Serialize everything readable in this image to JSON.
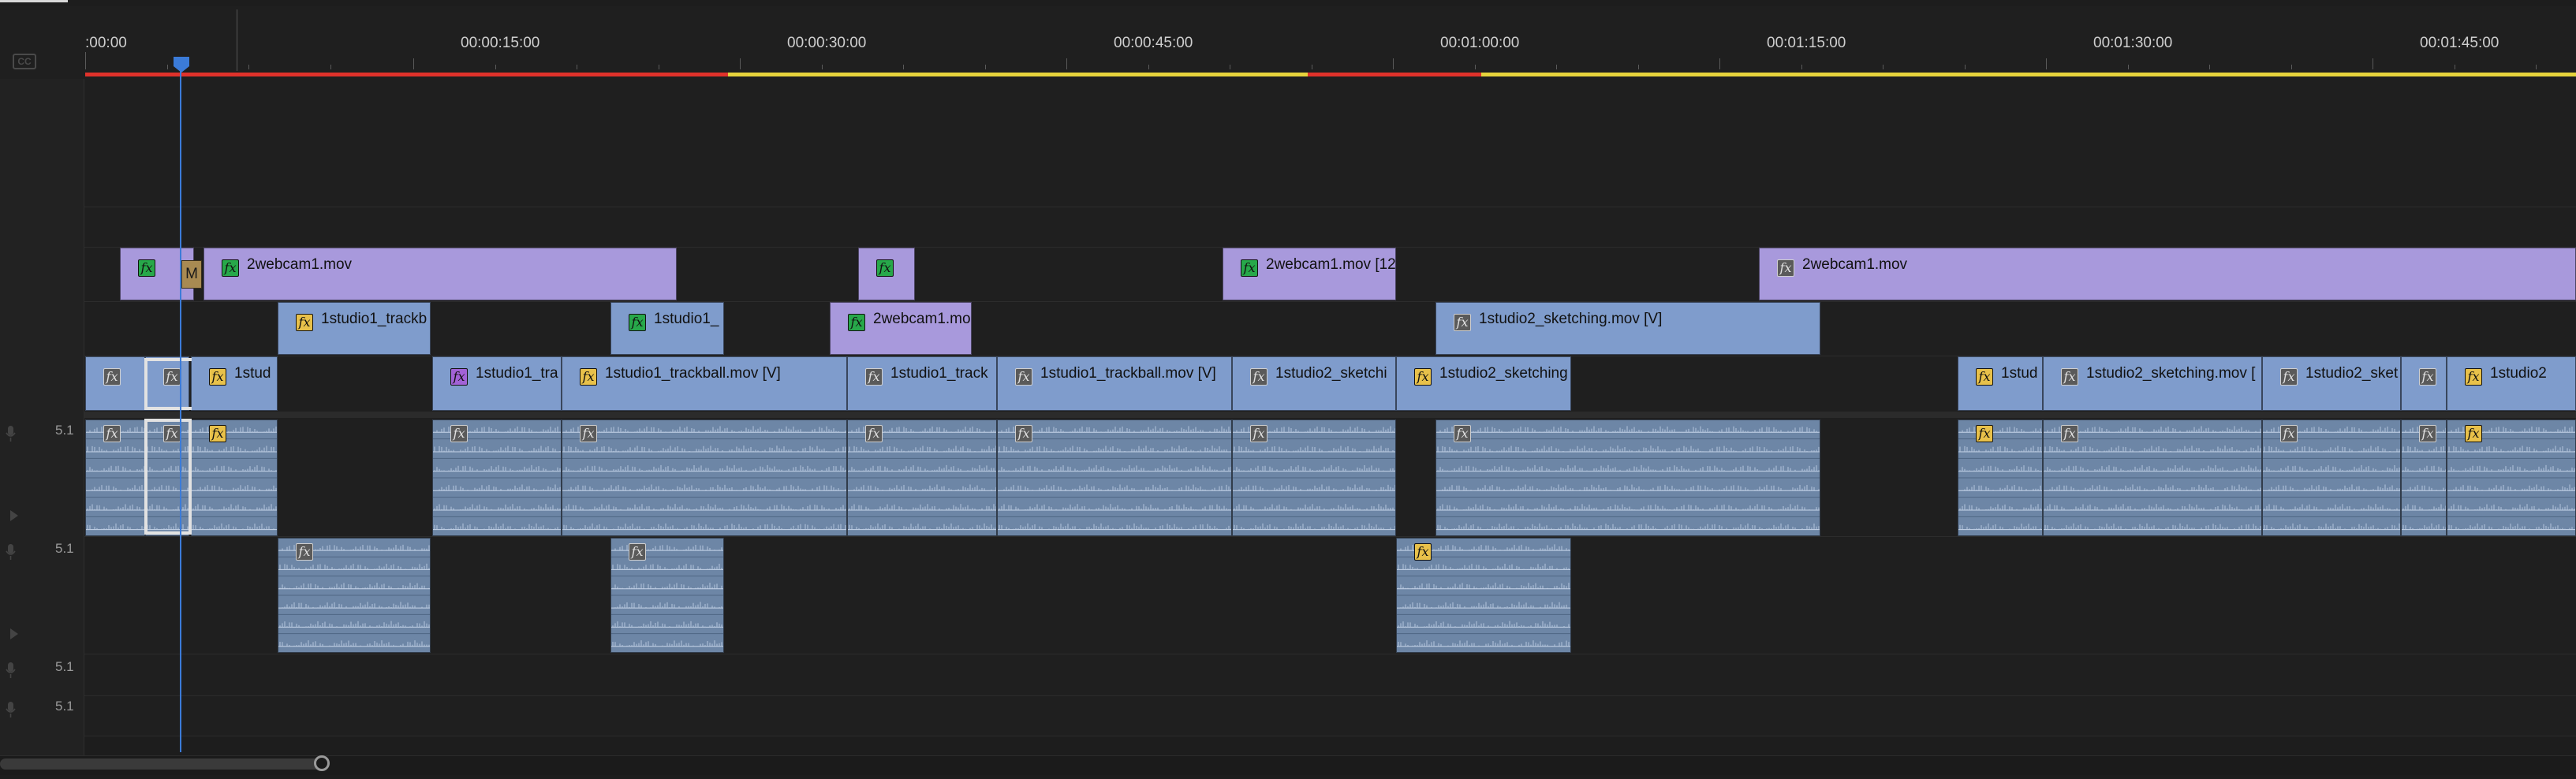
{
  "timecodes": [
    ":00:00",
    "00:00:15:00",
    "00:00:30:00",
    "00:00:45:00",
    "00:01:00:00",
    "00:01:15:00",
    "00:01:30:00",
    "00:01:45:00"
  ],
  "cc_label": "CC",
  "colors": {
    "video": "#7f9ccc",
    "video_purple": "#a899dc",
    "audio": "#6d86a6",
    "playhead": "#3b7bd8",
    "render_red": "#e0322b",
    "render_yellow": "#e6d33c",
    "fx_green": "#27a84a",
    "fx_yellow": "#e8c14a",
    "fx_gray": "#5a5a5a",
    "fx_purple": "#a262d6"
  },
  "audio_tracks": [
    {
      "label": "5.1"
    },
    {
      "label": "5.1"
    },
    {
      "label": "5.1"
    },
    {
      "label": "5.1"
    }
  ],
  "marker_label": "M",
  "clips": {
    "v3": [
      {
        "name": "",
        "fx": "green",
        "color": "purple"
      },
      {
        "name": "2webcam1.mov",
        "fx": "green",
        "color": "purple"
      },
      {
        "name": "",
        "fx": "green",
        "color": "purple"
      },
      {
        "name": "2webcam1.mov [12",
        "fx": "green",
        "color": "purple"
      },
      {
        "name": "2webcam1.mov",
        "fx": "gray",
        "color": "purple"
      }
    ],
    "v2": [
      {
        "name": "1studio1_trackb",
        "fx": "yellow",
        "color": "blue"
      },
      {
        "name": "1studio1_",
        "fx": "green",
        "color": "blue"
      },
      {
        "name": "2webcam1.mo",
        "fx": "green",
        "color": "purple"
      },
      {
        "name": "1studio2_sketching.mov [V]",
        "fx": "gray",
        "color": "blue"
      }
    ],
    "v1": [
      {
        "name": "",
        "fx": "gray",
        "color": "blue"
      },
      {
        "name": "",
        "fx": "gray",
        "color": "blue"
      },
      {
        "name": "1stud",
        "fx": "yellow",
        "color": "blue"
      },
      {
        "name": "1studio1_tra",
        "fx": "purple",
        "color": "blue"
      },
      {
        "name": "1studio1_trackball.mov [V]",
        "fx": "yellow",
        "color": "blue"
      },
      {
        "name": "1studio1_track",
        "fx": "gray",
        "color": "blue"
      },
      {
        "name": "1studio1_trackball.mov [V]",
        "fx": "gray",
        "color": "blue"
      },
      {
        "name": "1studio2_sketchi",
        "fx": "gray",
        "color": "blue"
      },
      {
        "name": "1studio2_sketching",
        "fx": "yellow",
        "color": "blue"
      },
      {
        "name": "1stud",
        "fx": "yellow",
        "color": "blue"
      },
      {
        "name": "1studio2_sketching.mov [",
        "fx": "gray",
        "color": "blue"
      },
      {
        "name": "1studio2_sket",
        "fx": "gray",
        "color": "blue"
      },
      {
        "name": "",
        "fx": "gray",
        "color": "blue"
      },
      {
        "name": "1studio2",
        "fx": "yellow",
        "color": "blue"
      }
    ],
    "a1": [
      {
        "fx": "gray"
      },
      {
        "fx": "gray"
      },
      {
        "fx": "yellow"
      },
      {
        "fx": "gray"
      },
      {
        "fx": "gray"
      },
      {
        "fx": "gray"
      },
      {
        "fx": "gray"
      },
      {
        "fx": "gray"
      },
      {
        "fx": "gray"
      },
      {
        "fx": "yellow"
      },
      {
        "fx": "gray"
      },
      {
        "fx": "gray"
      },
      {
        "fx": "gray"
      },
      {
        "fx": "yellow"
      }
    ],
    "a2": [
      {
        "fx": "gray"
      },
      {
        "fx": "gray"
      },
      {
        "fx": "yellow"
      }
    ]
  }
}
